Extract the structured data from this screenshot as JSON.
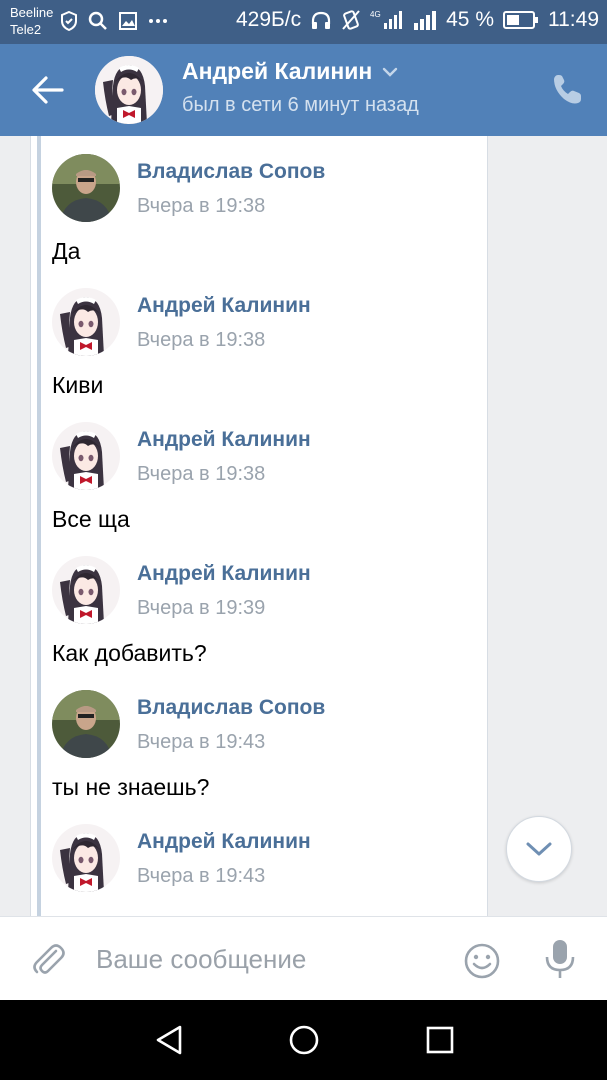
{
  "status_bar": {
    "carrier_1": "Beeline",
    "carrier_2": "Tele2",
    "speed": "429Б/с",
    "battery": "45 %",
    "time": "11:49",
    "network": "4G"
  },
  "header": {
    "contact_name": "Андрей Калинин",
    "status": "был в сети 6 минут назад",
    "accent_color": "#5181b8"
  },
  "messages": [
    {
      "author": "Владислав Сопов",
      "time": "Вчера в 19:38",
      "text": "Да",
      "avatar": "photo-avatar"
    },
    {
      "author": "Андрей Калинин",
      "time": "Вчера в 19:38",
      "text": "Киви",
      "avatar": "anime-avatar"
    },
    {
      "author": "Андрей Калинин",
      "time": "Вчера в 19:38",
      "text": "Все ща",
      "avatar": "anime-avatar"
    },
    {
      "author": "Андрей Калинин",
      "time": "Вчера в 19:39",
      "text": "Как добавить?",
      "avatar": "anime-avatar"
    },
    {
      "author": "Владислав Сопов",
      "time": "Вчера в 19:43",
      "text": "ты не знаешь?",
      "avatar": "photo-avatar"
    },
    {
      "author": "Андрей Калинин",
      "time": "Вчера в 19:43",
      "text": "",
      "avatar": "anime-avatar"
    }
  ],
  "compose": {
    "placeholder": "Ваше сообщение",
    "value": ""
  },
  "icons": {
    "back": "arrow-left-icon",
    "call": "phone-icon",
    "chevron": "chevron-down-icon",
    "attach": "paperclip-icon",
    "emoji": "smile-icon",
    "mic": "microphone-icon",
    "scroll": "chevron-down-icon",
    "nav_back": "triangle-back-icon",
    "nav_home": "circle-home-icon",
    "nav_recent": "square-recent-icon"
  }
}
